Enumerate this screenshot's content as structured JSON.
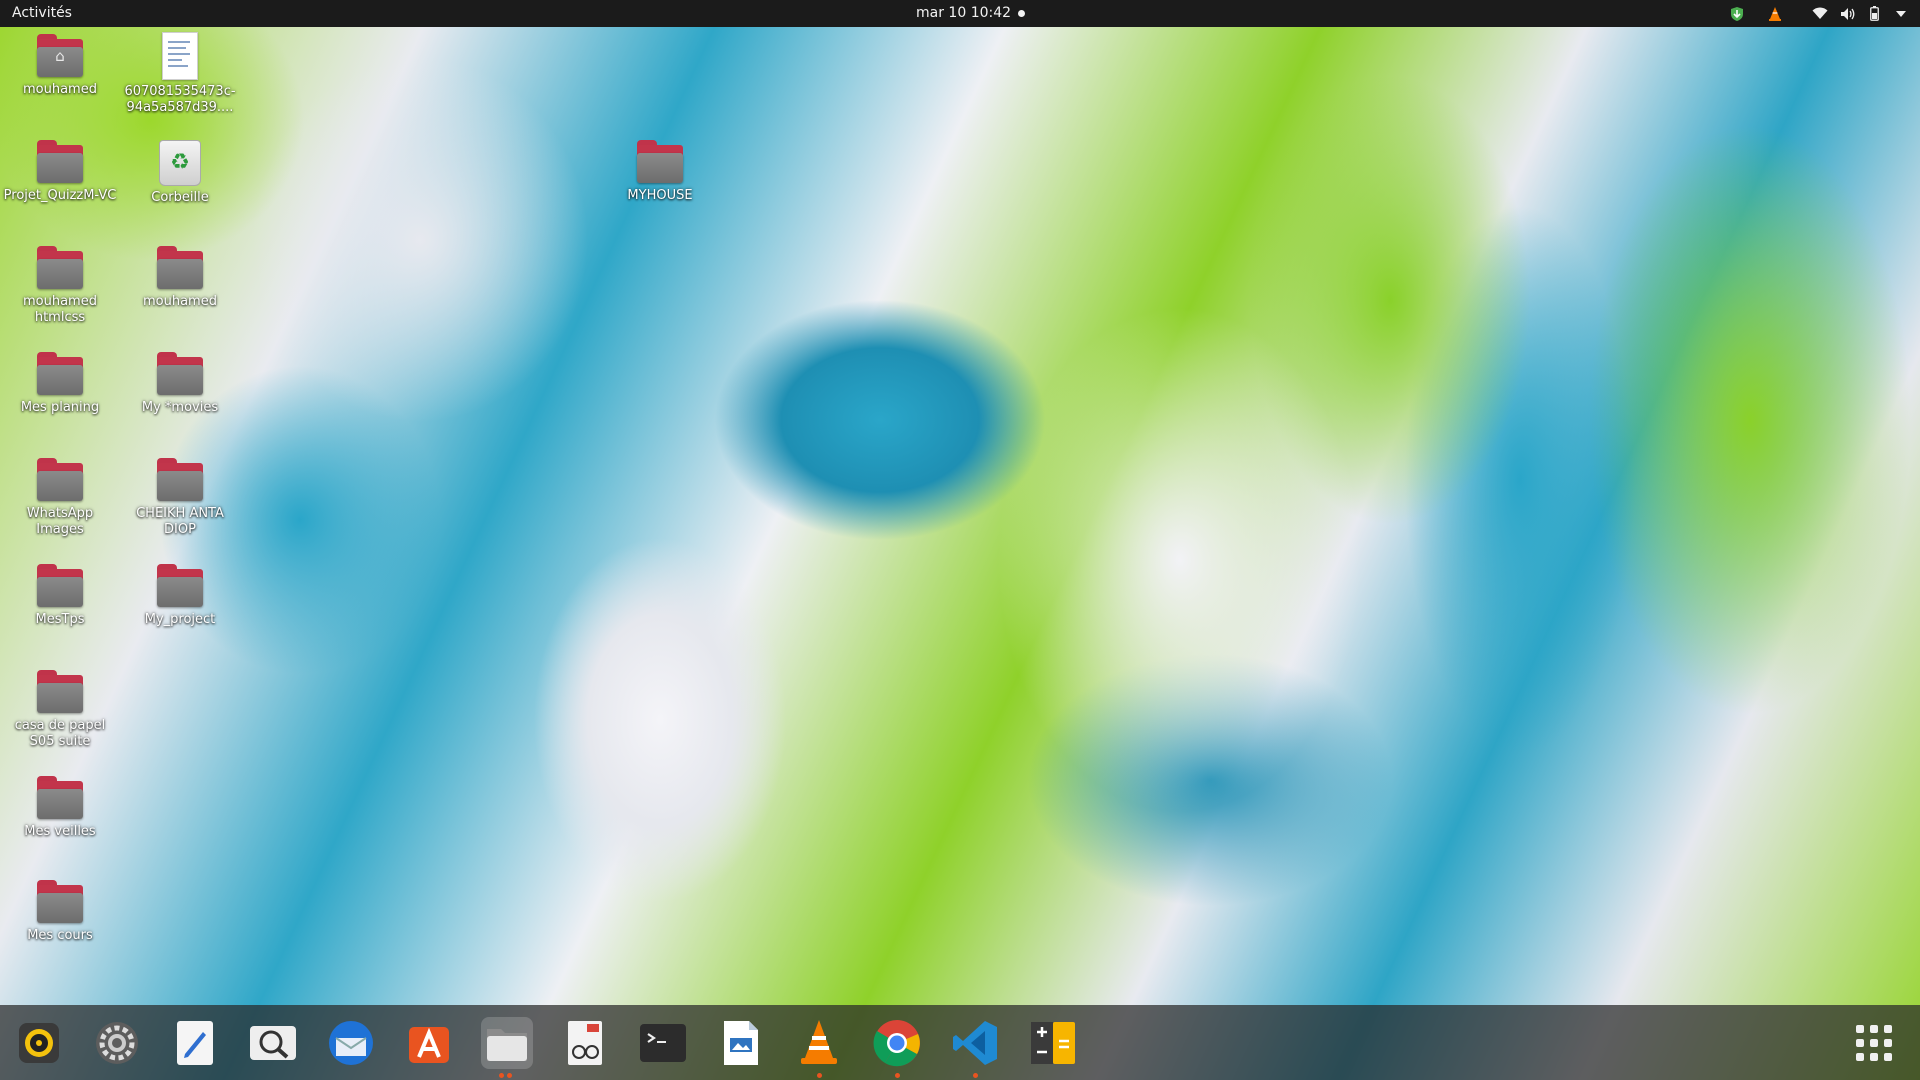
{
  "topbar": {
    "activities": "Activités",
    "clock": "mar 10  10:42"
  },
  "tray": {
    "icons": [
      "shield-update-icon",
      "vlc-tray-icon",
      "wifi-icon",
      "volume-icon",
      "battery-icon",
      "menu-arrow-icon"
    ]
  },
  "desktop": {
    "items": [
      {
        "label": "mouhamed",
        "type": "home-folder"
      },
      {
        "label": "607081535473c-94a5a587d39....",
        "type": "document"
      },
      {
        "label": "Projet_QuizzM-VC",
        "type": "folder"
      },
      {
        "label": "Corbeille",
        "type": "trash"
      },
      {
        "label": "MYHOUSE",
        "type": "folder"
      },
      {
        "label": "mouhamed htmlcss",
        "type": "folder"
      },
      {
        "label": "mouhamed",
        "type": "folder"
      },
      {
        "label": "Mes planing",
        "type": "folder"
      },
      {
        "label": "My *movies",
        "type": "folder"
      },
      {
        "label": "WhatsApp Images",
        "type": "folder"
      },
      {
        "label": "CHEIKH ANTA DIOP",
        "type": "folder"
      },
      {
        "label": "MesTps",
        "type": "folder"
      },
      {
        "label": "My_project",
        "type": "folder"
      },
      {
        "label": "casa de papel S05 suite",
        "type": "folder"
      },
      {
        "label": "Mes veilles",
        "type": "folder"
      },
      {
        "label": "Mes cours",
        "type": "folder"
      }
    ]
  },
  "dock": {
    "apps": [
      {
        "name": "rhythmbox-icon"
      },
      {
        "name": "settings-icon"
      },
      {
        "name": "text-editor-icon"
      },
      {
        "name": "screenshot-viewer-icon"
      },
      {
        "name": "thunderbird-icon"
      },
      {
        "name": "app-store-icon"
      },
      {
        "name": "files-icon",
        "running": true
      },
      {
        "name": "document-viewer-icon"
      },
      {
        "name": "terminal-icon"
      },
      {
        "name": "libreoffice-writer-icon"
      },
      {
        "name": "vlc-icon",
        "running": true
      },
      {
        "name": "chrome-icon",
        "running": true
      },
      {
        "name": "vscode-icon",
        "running": true
      },
      {
        "name": "calculator-icon"
      }
    ],
    "show_apps": "show-applications-icon"
  }
}
